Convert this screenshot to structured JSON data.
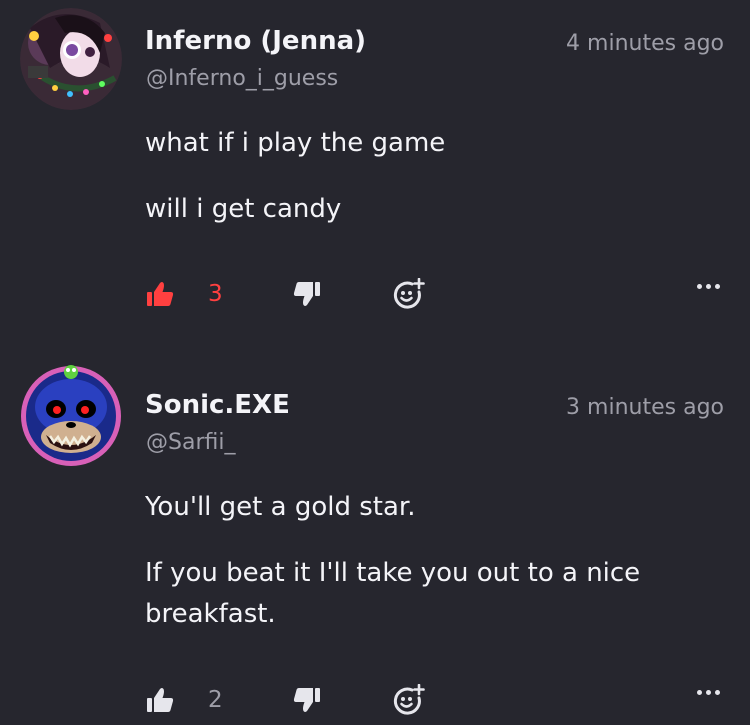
{
  "comments": [
    {
      "name": "Inferno (Jenna)",
      "handle": "@Inferno_i_guess",
      "time": "4 minutes ago",
      "paragraphs": [
        "what if i play the game",
        "will i get candy"
      ],
      "likes": "3",
      "liked": true,
      "icons": {
        "like": "thumbs-up-icon",
        "dislike": "thumbs-down-icon",
        "react": "add-reaction-icon",
        "more": "more-options-icon"
      }
    },
    {
      "name": "Sonic.EXE",
      "handle": "@Sarfii_",
      "time": "3 minutes ago",
      "paragraphs": [
        "You'll get a gold star.",
        "If you beat it I'll take you out to a nice breakfast."
      ],
      "likes": "2",
      "liked": false,
      "icons": {
        "like": "thumbs-up-icon",
        "dislike": "thumbs-down-icon",
        "react": "add-reaction-icon",
        "more": "more-options-icon"
      }
    }
  ],
  "colors": {
    "background": "#26262e",
    "liked_red": "#ff4040",
    "muted": "#9e9ea8",
    "text": "#f4f4f8"
  }
}
